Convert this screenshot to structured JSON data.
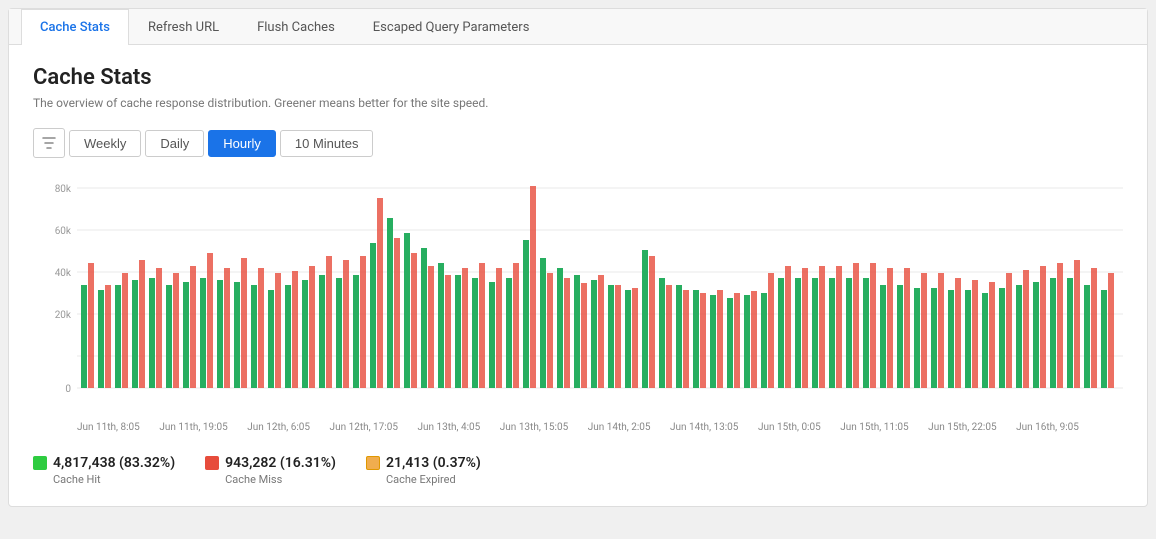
{
  "tabs": [
    {
      "id": "cache-stats",
      "label": "Cache Stats",
      "active": true
    },
    {
      "id": "refresh-url",
      "label": "Refresh URL",
      "active": false
    },
    {
      "id": "flush-caches",
      "label": "Flush Caches",
      "active": false
    },
    {
      "id": "escaped-query",
      "label": "Escaped Query Parameters",
      "active": false
    }
  ],
  "title": "Cache Stats",
  "subtitle": "The overview of cache response distribution. Greener means better for the site speed.",
  "filters": [
    {
      "id": "weekly",
      "label": "Weekly",
      "active": false
    },
    {
      "id": "daily",
      "label": "Daily",
      "active": false
    },
    {
      "id": "hourly",
      "label": "Hourly",
      "active": true
    },
    {
      "id": "10min",
      "label": "10 Minutes",
      "active": false
    }
  ],
  "chart": {
    "y_labels": [
      "80k",
      "60k",
      "40k",
      "20k",
      "0"
    ],
    "x_labels": [
      "Jun 11th, 8:05",
      "Jun 11th, 19:05",
      "Jun 12th, 6:05",
      "Jun 12th, 17:05",
      "Jun 13th, 4:05",
      "Jun 13th, 15:05",
      "Jun 14th, 2:05",
      "Jun 14th, 13:05",
      "Jun 15th, 0:05",
      "Jun 15th, 11:05",
      "Jun 15th, 22:05",
      "Jun 16th, 9:05"
    ]
  },
  "legend": [
    {
      "id": "cache-hit",
      "color": "green",
      "value": "4,817,438 (83.32%)",
      "label": "Cache Hit"
    },
    {
      "id": "cache-miss",
      "color": "red",
      "value": "943,282 (16.31%)",
      "label": "Cache Miss"
    },
    {
      "id": "cache-expired",
      "color": "yellow",
      "value": "21,413 (0.37%)",
      "label": "Cache Expired"
    }
  ]
}
